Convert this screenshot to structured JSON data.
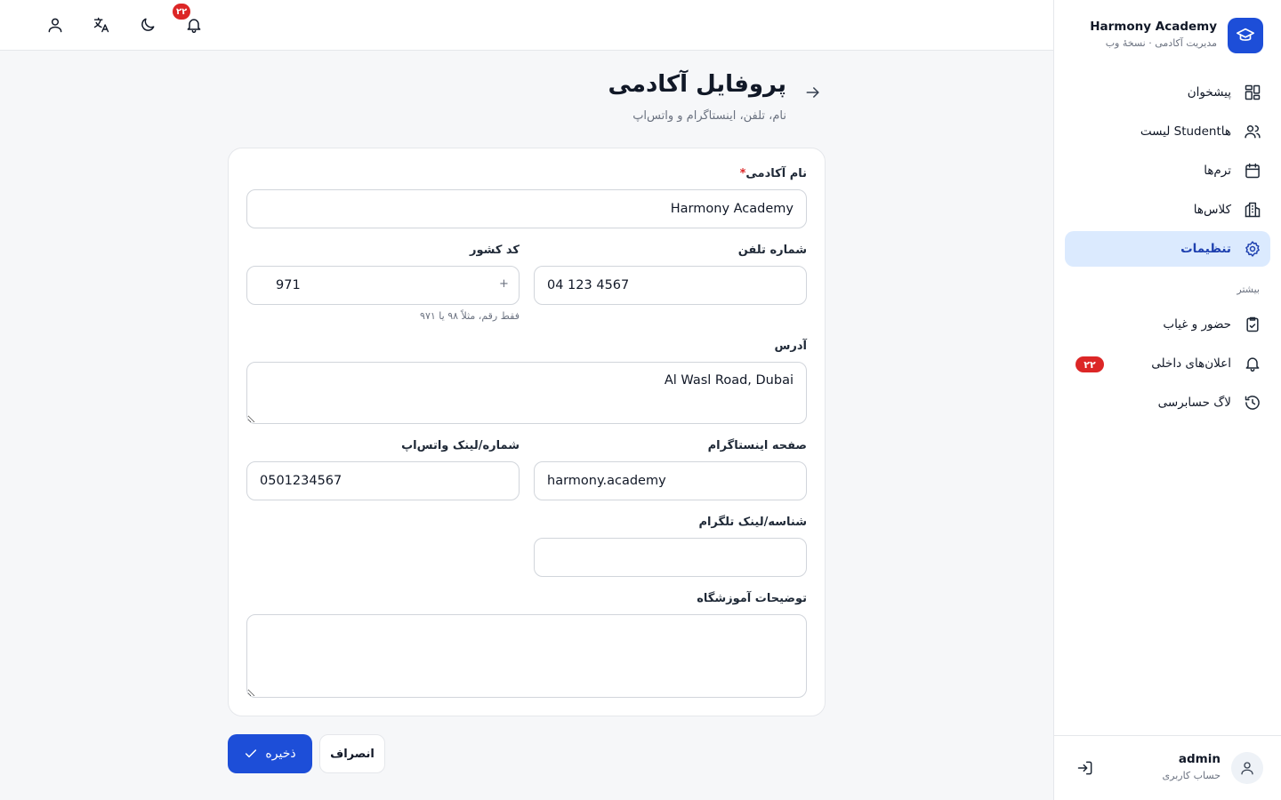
{
  "brand": {
    "name": "Harmony Academy",
    "subtitle": "مدیریت آکادمی · نسخهٔ وب"
  },
  "nav": {
    "items": [
      {
        "label": "پیشخوان",
        "icon": "dashboard-icon"
      },
      {
        "label": "لیست Studentها",
        "icon": "users-icon"
      },
      {
        "label": "ترم‌ها",
        "icon": "calendar-icon"
      },
      {
        "label": "کلاس‌ها",
        "icon": "building-icon"
      },
      {
        "label": "تنظیمات",
        "icon": "gear-icon",
        "active": true
      }
    ],
    "more_label": "بیشتر",
    "more_items": [
      {
        "label": "حضور و غیاب",
        "icon": "clipboard-icon"
      },
      {
        "label": "اعلان‌های داخلی",
        "icon": "bell-icon",
        "badge": "۲۲"
      },
      {
        "label": "لاگ حسابرسی",
        "icon": "history-icon"
      }
    ]
  },
  "user": {
    "name": "admin",
    "role": "حساب کاربری"
  },
  "topbar": {
    "notification_count": "۲۲"
  },
  "page": {
    "title": "پروفایل آکادمی",
    "subtitle": "نام، تلفن، اینستاگرام و واتس‌اپ"
  },
  "form": {
    "academy_name": {
      "label": "نام آکادمی",
      "required_mark": "*",
      "value": "Harmony Academy"
    },
    "phone": {
      "label": "شماره تلفن",
      "value": "04 123 4567"
    },
    "country_code": {
      "label": "کد کشور",
      "prefix": "+",
      "value": "971",
      "hint": "فقط رقم، مثلاً ۹۸ یا ۹۷۱"
    },
    "address": {
      "label": "آدرس",
      "value": "Al Wasl Road, Dubai"
    },
    "instagram": {
      "label": "صفحه اینستاگرام",
      "value": "harmony.academy"
    },
    "whatsapp": {
      "label": "شماره/لینک واتس‌اپ",
      "value": "0501234567"
    },
    "telegram": {
      "label": "شناسه/لینک تلگرام",
      "value": ""
    },
    "description": {
      "label": "توضیحات آموزشگاه",
      "value": ""
    }
  },
  "actions": {
    "save_label": "ذخیره",
    "cancel_label": "انصراف"
  },
  "colors": {
    "primary": "#1d4ed8",
    "active_bg": "#dbeafe",
    "badge": "#dc2626"
  }
}
